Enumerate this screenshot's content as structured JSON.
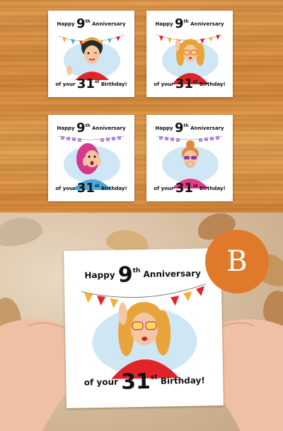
{
  "cards": [
    {
      "happy": "Happy",
      "number": "9",
      "suffix": "th",
      "anniversary": "Anniversary",
      "of_your": "of your",
      "age": "31",
      "age_suffix": "st",
      "birthday": "Birthday!"
    },
    {
      "happy": "Happy",
      "number": "9",
      "suffix": "th",
      "anniversary": "Anniversary",
      "of_your": "of your",
      "age": "31",
      "age_suffix": "st",
      "birthday": "Birthday!"
    },
    {
      "happy": "Happy",
      "number": "9",
      "suffix": "th",
      "anniversary": "Anniversary",
      "of_your": "of your",
      "age": "31",
      "age_suffix": "st",
      "birthday": "Birthday!"
    },
    {
      "happy": "Happy",
      "number": "9",
      "suffix": "th",
      "anniversary": "Anniversary",
      "of_your": "of your",
      "age": "31",
      "age_suffix": "st",
      "birthday": "Birthday!"
    }
  ],
  "featured": {
    "happy": "Happy",
    "number": "9",
    "suffix": "th",
    "anniversary": "Anniversary",
    "of_your": "of your",
    "age": "31",
    "age_suffix": "st",
    "birthday": "Birthday!"
  },
  "badge_label": "B",
  "colors": {
    "badge": "#e07a2a",
    "sweater": "#e0242a",
    "wood": "#dc9244"
  }
}
